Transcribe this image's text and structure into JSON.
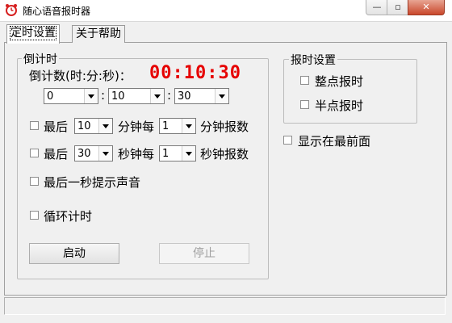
{
  "window": {
    "title": "随心语音报时器",
    "min": "—",
    "max": "▫",
    "close": "✕"
  },
  "tabs": [
    {
      "label": "定时设置"
    },
    {
      "label": "关于帮助"
    }
  ],
  "countdown": {
    "group_label": "倒计时",
    "format_label": "倒计数(时:分:秒)：",
    "display": "00:10:30",
    "hours": "0",
    "minutes": "10",
    "seconds": "30",
    "sep": ":"
  },
  "minute_report": {
    "prefix": "最后",
    "value": "10",
    "mid": "分钟每",
    "interval": "1",
    "suffix": "分钟报数"
  },
  "second_report": {
    "prefix": "最后",
    "value": "30",
    "mid": "秒钟每",
    "interval": "1",
    "suffix": "秒钟报数"
  },
  "last_second_sound": "最后一秒提示声音",
  "loop_timer": "循环计时",
  "buttons": {
    "start": "启动",
    "stop": "停止"
  },
  "hourly": {
    "group_label": "报时设置",
    "on_the_hour": "整点报时",
    "half_hour": "半点报时"
  },
  "always_on_top": "显示在最前面",
  "colors": {
    "display": "#e60000"
  }
}
